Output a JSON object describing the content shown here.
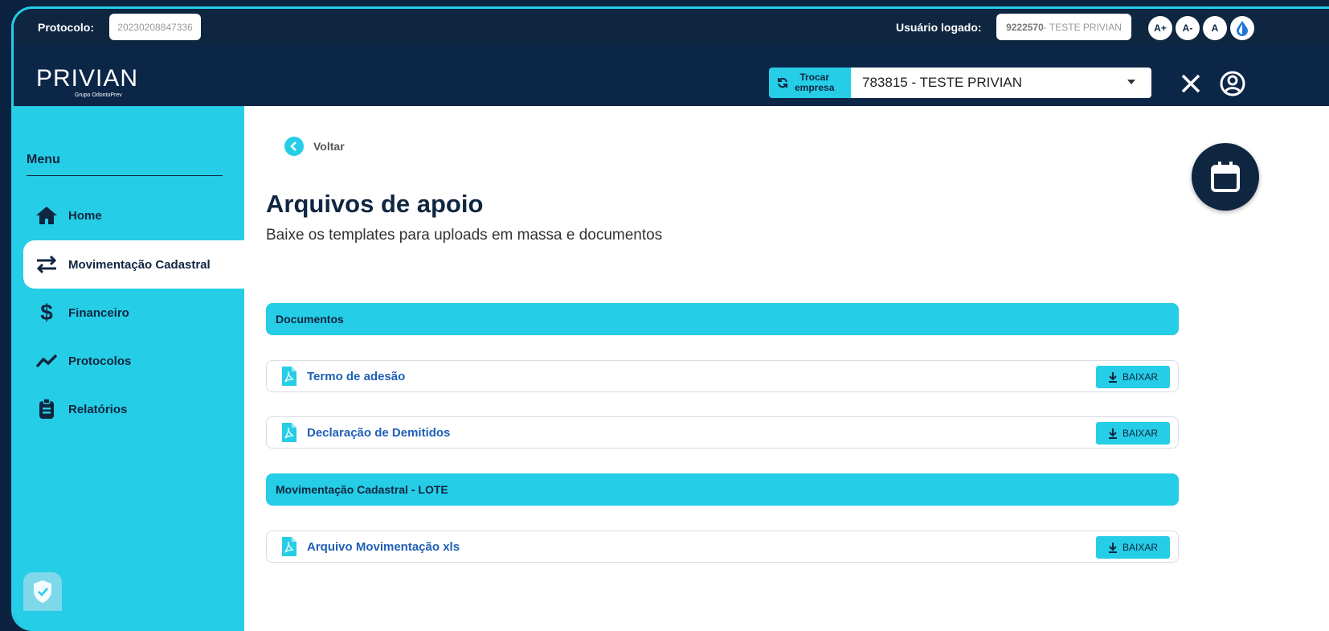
{
  "topbar": {
    "protocol_label": "Protocolo:",
    "protocol_value": "20230208847336",
    "user_label": "Usuário logado:",
    "user_id": "9222570",
    "user_name": " - TESTE PRIVIAN",
    "access": {
      "increase": "A+",
      "decrease": "A-",
      "reset": "A"
    }
  },
  "header": {
    "logo": "PRIVIAN",
    "logo_sub": "Grupo OdontoPrev",
    "switch_company_line1": "Trocar",
    "switch_company_line2": "empresa",
    "company_selected": "783815 - TESTE PRIVIAN"
  },
  "sidebar": {
    "title": "Menu",
    "items": [
      {
        "label": "Home",
        "icon": "home-icon"
      },
      {
        "label": "Movimentação Cadastral",
        "icon": "arrows-exchange-icon",
        "active": true
      },
      {
        "label": "Financeiro",
        "icon": "dollar-icon"
      },
      {
        "label": "Protocolos",
        "icon": "trend-line-icon"
      },
      {
        "label": "Relatórios",
        "icon": "report-icon"
      }
    ]
  },
  "main": {
    "back_label": "Voltar",
    "title": "Arquivos de apoio",
    "subtitle": "Baixe os templates para uploads em massa e documentos",
    "sections": [
      {
        "title": "Documentos",
        "files": [
          "Termo de adesão",
          "Declaração de Demitidos"
        ]
      },
      {
        "title": "Movimentação Cadastral - LOTE",
        "files": [
          "Arquivo Movimentação xls"
        ]
      }
    ],
    "download_label": "BAIXAR"
  },
  "colors": {
    "accent": "#26cde6",
    "navy": "#0f2641",
    "link": "#1f5fb5"
  }
}
